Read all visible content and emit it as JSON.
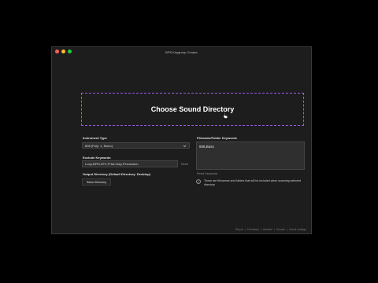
{
  "app": {
    "title": "BPS Keygroup Creator"
  },
  "drop_zone": {
    "label": "Choose Sound Directory"
  },
  "instrument": {
    "label": "Instrument Type",
    "selected": "808 (Poly: 1, Mono)"
  },
  "exclude": {
    "label": "Exclude Keywords",
    "value": "Loop,BPM,SFX,FHat,Clap,Percussion",
    "reset": "Reset"
  },
  "output": {
    "label": "Output Directory (Default Directory: Desktop)",
    "button": "Select Directory"
  },
  "filename": {
    "label": "Filename/Folder Keywords",
    "value": "808,Bass",
    "reset": "Reset Keywords"
  },
  "info": {
    "text": "These are filenames and folders that will be included when scanning selected directory"
  },
  "footer": {
    "items": [
      "Report",
      "Feedback",
      "Website",
      "Donate"
    ],
    "separator": "|",
    "last": "Check settings"
  },
  "icons": {
    "cursor": "hand-pointer-icon",
    "info": "info-circle-icon",
    "chevron": "chevron-down-icon"
  }
}
